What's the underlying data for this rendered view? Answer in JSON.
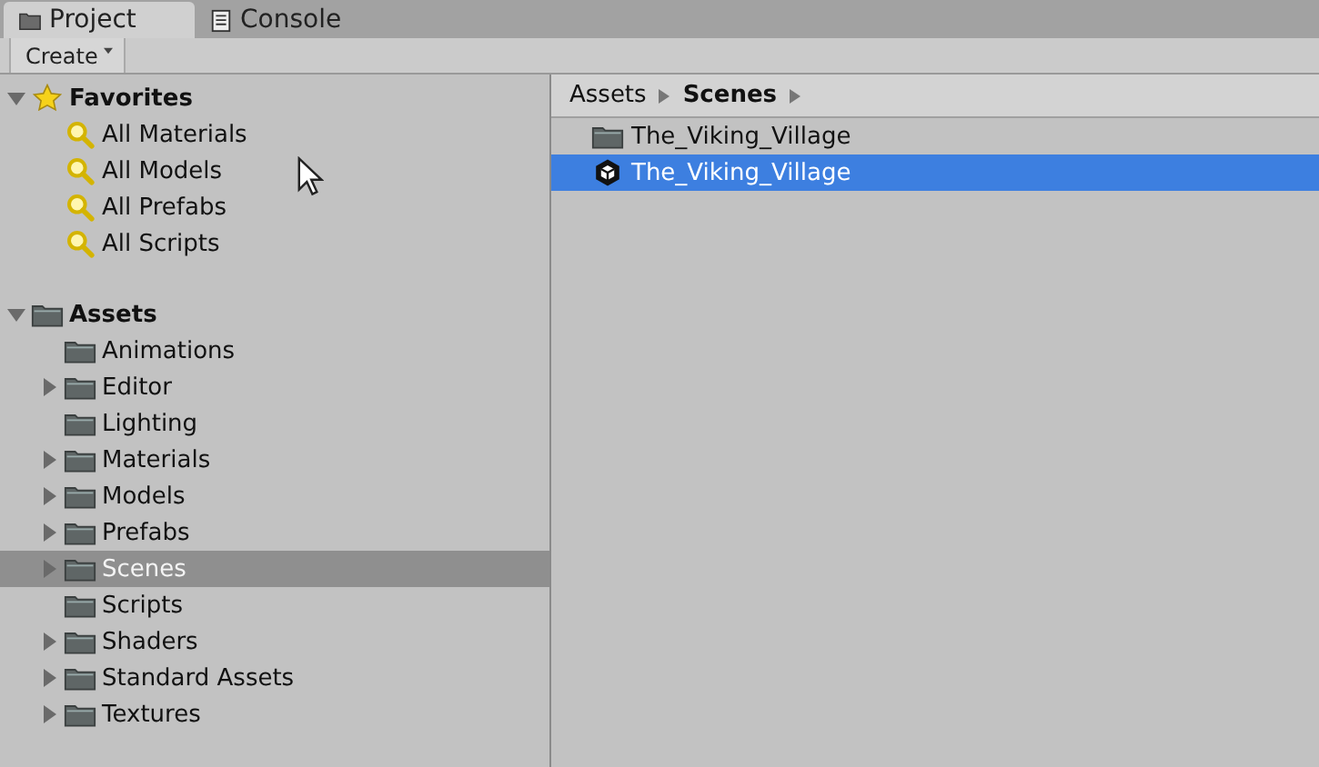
{
  "tabs": [
    {
      "label": "Project",
      "kind": "project",
      "selected": true
    },
    {
      "label": "Console",
      "kind": "console",
      "selected": false
    }
  ],
  "toolbar": {
    "create_button": "Create"
  },
  "tree": [
    {
      "label": "Favorites",
      "kind": "favorites",
      "expanded": true,
      "children": [
        {
          "label": "All Materials",
          "kind": "search"
        },
        {
          "label": "All Models",
          "kind": "search"
        },
        {
          "label": "All Prefabs",
          "kind": "search"
        },
        {
          "label": "All Scripts",
          "kind": "search"
        }
      ]
    },
    {
      "label": "Assets",
      "kind": "folder",
      "expanded": true,
      "children": [
        {
          "label": "Animations",
          "kind": "folder",
          "expandable": false,
          "selected": false
        },
        {
          "label": "Editor",
          "kind": "folder",
          "expandable": true,
          "selected": false
        },
        {
          "label": "Lighting",
          "kind": "folder",
          "expandable": false,
          "selected": false
        },
        {
          "label": "Materials",
          "kind": "folder",
          "expandable": true,
          "selected": false
        },
        {
          "label": "Models",
          "kind": "folder",
          "expandable": true,
          "selected": false
        },
        {
          "label": "Prefabs",
          "kind": "folder",
          "expandable": true,
          "selected": false
        },
        {
          "label": "Scenes",
          "kind": "folder",
          "expandable": true,
          "selected": true
        },
        {
          "label": "Scripts",
          "kind": "folder",
          "expandable": false,
          "selected": false
        },
        {
          "label": "Shaders",
          "kind": "folder",
          "expandable": true,
          "selected": false
        },
        {
          "label": "Standard Assets",
          "kind": "folder",
          "expandable": true,
          "selected": false
        },
        {
          "label": "Textures",
          "kind": "folder",
          "expandable": true,
          "selected": false
        }
      ]
    }
  ],
  "breadcrumb": [
    "Assets",
    "Scenes"
  ],
  "files": [
    {
      "name": "The_Viking_Village",
      "kind": "folder",
      "selected": false
    },
    {
      "name": "The_Viking_Village",
      "kind": "scene",
      "selected": true
    }
  ]
}
